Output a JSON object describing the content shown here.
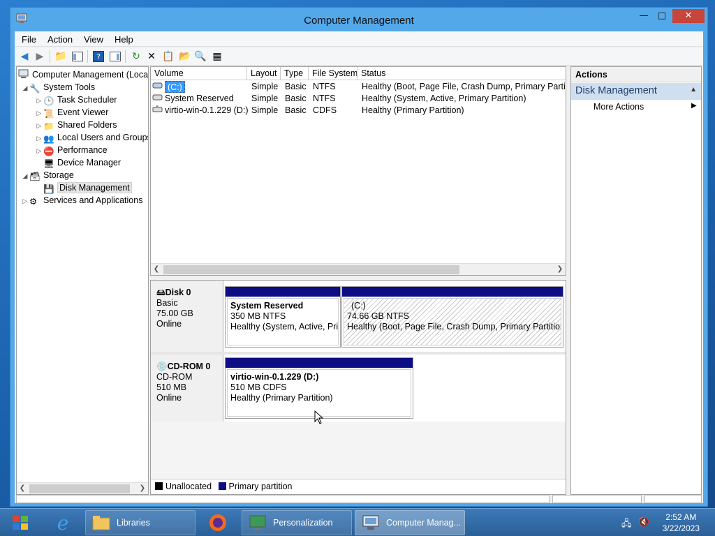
{
  "window": {
    "title": "Computer Management"
  },
  "menu": [
    "File",
    "Action",
    "View",
    "Help"
  ],
  "tree": {
    "root": "Computer Management (Local",
    "system_tools": "System Tools",
    "task_scheduler": "Task Scheduler",
    "event_viewer": "Event Viewer",
    "shared_folders": "Shared Folders",
    "local_users": "Local Users and Groups",
    "performance": "Performance",
    "device_manager": "Device Manager",
    "storage": "Storage",
    "disk_management": "Disk Management",
    "services": "Services and Applications"
  },
  "volume_list": {
    "headers": [
      "Volume",
      "Layout",
      "Type",
      "File System",
      "Status"
    ],
    "rows": [
      [
        "(C:)",
        "Simple",
        "Basic",
        "NTFS",
        "Healthy (Boot, Page File, Crash Dump, Primary Partition"
      ],
      [
        "System Reserved",
        "Simple",
        "Basic",
        "NTFS",
        "Healthy (System, Active, Primary Partition)"
      ],
      [
        "virtio-win-0.1.229 (D:)",
        "Simple",
        "Basic",
        "CDFS",
        "Healthy (Primary Partition)"
      ]
    ]
  },
  "disks": {
    "disk0": {
      "name": "Disk 0",
      "type": "Basic",
      "size": "75.00 GB",
      "state": "Online",
      "p1": {
        "name": "System Reserved",
        "size": "350 MB NTFS",
        "status": "Healthy (System, Active, Prin"
      },
      "p2": {
        "name": "(C:)",
        "size": "74.66 GB NTFS",
        "status": "Healthy (Boot, Page File, Crash Dump, Primary Partition)"
      }
    },
    "cdrom0": {
      "name": "CD-ROM 0",
      "type": "CD-ROM",
      "size": "510 MB",
      "state": "Online",
      "p1": {
        "name": "virtio-win-0.1.229  (D:)",
        "size": "510 MB CDFS",
        "status": "Healthy (Primary Partition)"
      }
    }
  },
  "legend": {
    "unallocated": "Unallocated",
    "primary": "Primary partition",
    "unallocated_color": "#000000",
    "primary_color": "#0d0d84"
  },
  "actions": {
    "header": "Actions",
    "section": "Disk Management",
    "more": "More Actions"
  },
  "taskbar": {
    "libraries": "Libraries",
    "personalization": "Personalization",
    "computer_management": "Computer Manag...",
    "time": "2:52 AM",
    "date": "3/22/2023"
  }
}
